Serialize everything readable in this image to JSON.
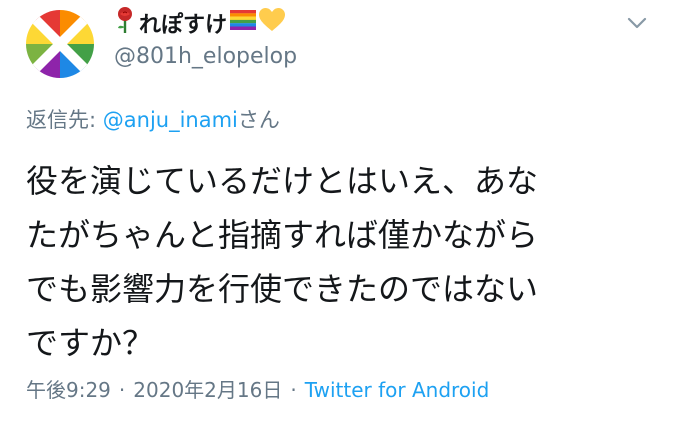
{
  "profile": {
    "display_name": "れぽすけ",
    "handle": "@801h_elopelop",
    "name_icons": [
      "rose-icon",
      "rainbow-flag-icon",
      "yellow-heart-icon"
    ]
  },
  "reply": {
    "prefix": "返信先: ",
    "mention": "@anju_inami",
    "suffix": "さん"
  },
  "tweet": {
    "text": "役を演じているだけとはいえ、あな\nたがちゃんと指摘すれば僅かながら\nでも影響力を行使できたのではない\nですか？"
  },
  "meta": {
    "time": "午後9:29",
    "separator": "·",
    "date": "2020年2月16日",
    "source": "Twitter for Android"
  },
  "colors": {
    "text": "#14171a",
    "secondary": "#657786",
    "link": "#1da1f2"
  }
}
